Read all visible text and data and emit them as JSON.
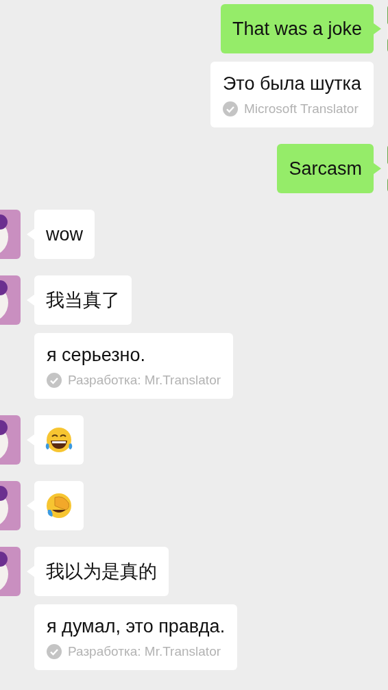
{
  "messages": [
    {
      "outgoing": true,
      "kind": "text",
      "text": "That was a joke",
      "translation": {
        "text": "Это была шутка",
        "source": "Microsoft Translator"
      }
    },
    {
      "outgoing": true,
      "kind": "text",
      "text": "Sarcasm"
    },
    {
      "outgoing": false,
      "kind": "text",
      "text": "wow"
    },
    {
      "outgoing": false,
      "kind": "text",
      "text": "我当真了",
      "translation": {
        "text": "я серьезно.",
        "source": "Разработка: Mr.Translator"
      }
    },
    {
      "outgoing": false,
      "kind": "laughing"
    },
    {
      "outgoing": false,
      "kind": "facepalm"
    },
    {
      "outgoing": false,
      "kind": "text",
      "text": "我以为是真的",
      "translation": {
        "text": "я думал, это правда.",
        "source": "Разработка: Mr.Translator"
      }
    }
  ]
}
